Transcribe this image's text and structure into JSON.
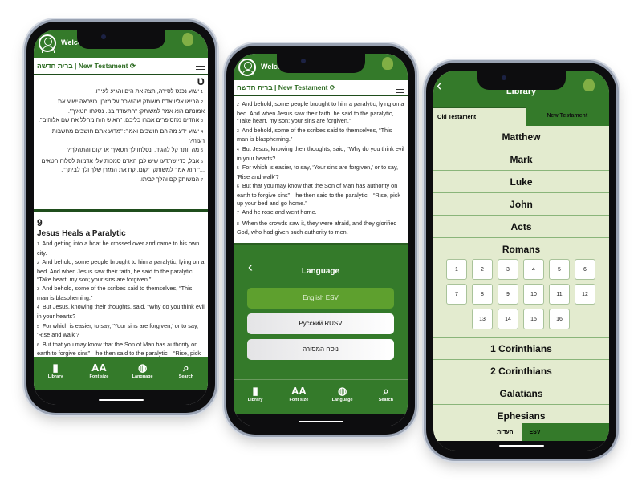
{
  "header": {
    "welcome": "Welcome!",
    "logo": "הגפן"
  },
  "subheader": {
    "title": "ברית חדשה | New Testament"
  },
  "hebrew": {
    "chapter": "ט",
    "verses": [
      {
        "n": "1",
        "t": "ישוע נכנס לסירה, חצה את הים והגיע לעירו."
      },
      {
        "n": "2",
        "t": "הביאו אליו אדם משותק שהושכב על מזרן. כשראה ישוע את אמונתם הוא אמר למשותק: \"התעודד בני. נסלחו חטאיך\"."
      },
      {
        "n": "3",
        "t": "אחדים מהסופרים אמרו בליבם: \"האיש הזה מחלל את שם אלוהים\"."
      },
      {
        "n": "4",
        "t": "ישוע ידע מה הם חושבים ואמר: \"מדוע אתם חושבים מחשבות רעות?"
      },
      {
        "n": "5",
        "t": "מה יותר קל להגיד, 'נסלחו לך חטאיך' או 'קום והתהלך'?"
      },
      {
        "n": "6",
        "t": "אבל, כדי שתדעו שיש לבן האדם סמכות עלי אדמות לסלוח חטאים ...\" הוא אמר למשותק: \"קום. קח את המזרן שלך ולך לביתך\"."
      },
      {
        "n": "7",
        "t": "המשותק קם והלך לביתו."
      }
    ]
  },
  "english": {
    "chapter": "9",
    "heading": "Jesus Heals a Paralytic",
    "verses": [
      {
        "n": "1",
        "t": "And getting into a boat he crossed over and came to his own city."
      },
      {
        "n": "2",
        "t": "And behold, some people brought to him a paralytic, lying on a bed. And when Jesus saw their faith, he said to the paralytic, “Take heart, my son; your sins are forgiven.”"
      },
      {
        "n": "3",
        "t": "And behold, some of the scribes said to themselves, “This man is blaspheming.”"
      },
      {
        "n": "4",
        "t": "But Jesus, knowing their thoughts, said, “Why do you think evil in your hearts?"
      },
      {
        "n": "5",
        "t": "For which is easier, to say, ‘Your sins are forgiven,’ or to say, ‘Rise and walk’?"
      },
      {
        "n": "6",
        "t": "But that you may know that the Son of Man has authority on earth to forgive sins”—he then said to the paralytic—“Rise, pick up your bed and go home.”"
      },
      {
        "n": "7",
        "t": "And he rose and went home."
      },
      {
        "n": "8",
        "t": "When the crowds saw it, they were afraid, and they glorified God, who had given such authority to men."
      }
    ]
  },
  "nav": [
    {
      "label": "Library",
      "icon": "book-icon"
    },
    {
      "label": "Font size",
      "icon": "font-size-icon"
    },
    {
      "label": "Language",
      "icon": "globe-icon"
    },
    {
      "label": "Search",
      "icon": "search-icon"
    }
  ],
  "language": {
    "title": "Language",
    "options": [
      {
        "label": "English ESV",
        "selected": true
      },
      {
        "label": "Русский RUSV",
        "selected": false
      },
      {
        "label": "נוסח המסורה",
        "selected": false
      }
    ]
  },
  "library": {
    "title": "Library",
    "tabs": [
      "Old Testament",
      "New Testament"
    ],
    "active_tab": "New Testament",
    "books_before": [
      "Matthew",
      "Mark",
      "Luke",
      "John",
      "Acts"
    ],
    "expanded": "Romans",
    "chapters": [
      "1",
      "2",
      "3",
      "4",
      "5",
      "6",
      "7",
      "8",
      "9",
      "10",
      "11",
      "12",
      "13",
      "14",
      "15",
      "16"
    ],
    "books_after": [
      "1 Corinthians",
      "2 Corinthians",
      "Galatians",
      "Ephesians"
    ],
    "versions": [
      "העדות",
      "ESV"
    ],
    "active_version": "ESV"
  },
  "colors": {
    "brand": "#347a2a",
    "selected": "#5ea02e",
    "list_bg": "#e3ebcf"
  }
}
